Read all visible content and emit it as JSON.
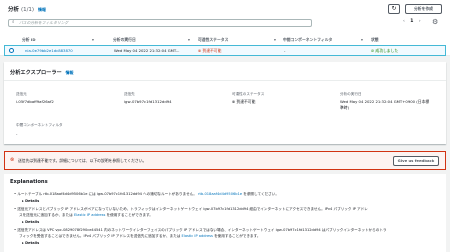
{
  "header": {
    "title": "分析",
    "count": "(1/1)",
    "info": "情報",
    "refresh_icon": "refresh-icon",
    "create_button": "分析を作成",
    "search_placeholder": "パスの分析をフィルタリング",
    "pager_prev": "‹",
    "pager_page": "1",
    "pager_next": "›"
  },
  "table": {
    "columns": [
      "分析 ID",
      "分析の実行日",
      "可達性ステータス",
      "中間コンポーネントフィルタ",
      "状態"
    ],
    "row": {
      "id": "nia-0e79bb2e1dc883870",
      "date": "Wed May 04 2022 21:32:04 GMT...",
      "reach": "到達不可能",
      "filter": "-",
      "state": "成功しました"
    }
  },
  "explorer": {
    "title": "分析エクスプローラー",
    "info": "情報",
    "source_label": "送信元",
    "source_value": "i-05f7dbaff9af26af2",
    "dest_label": "送信先",
    "dest_value": "igw-07b97c1fd1312dd94",
    "reach_label": "可達性のステータス",
    "reach_value": "到達不可能",
    "date_label": "分析の実行日",
    "date_value_1": "Wed May 04 2022 21:32:04 GMT+0900 (日本標",
    "date_value_2": "準時)",
    "filter_label": "中間コンポーネントフィルタ",
    "filter_value": "-"
  },
  "alert": {
    "text": "送信先は到達不能です。詳細については、以下の説明を参照してください。",
    "button": "Give us feedback"
  },
  "explanations": {
    "title": "Explanations",
    "items": [
      {
        "lead": "ルートテーブル rtb-018aaf4d4d9506b1e には igw-07b97c1fd1312dd94 への適切なルートがありません。",
        "link": "rtb-018aaf4d4d9506b1e",
        "tail": "を参照してください。",
        "details": "Details"
      },
      {
        "line1": "送信元アドレスとパブリック IP アドレスがペアになっていないため、トラフィックはインターネットゲートウェイ igw-07b97c1fd1312dd94 経由でインターネットにアクセスできません。IPv4 パブリック IP アドレ",
        "line2": "スを送信元に追加するか、または",
        "link": "Elastic IP address",
        "tail": "を使用することができます。",
        "details": "Details"
      },
      {
        "line1": "送信先アドレスは VPC vpc-0829078f290ce44541 内のネットワークインターフェイスのパブリック IP アドレスではない場合、インターネットゲートウェイ igw-07b97c1fd1312dd94 はパブリックインターネットからのトラ",
        "line2": "フィックを受信することはできません。IPv4 パブリック IP アドレスを送信先に追加するか、または",
        "link": "Elastic IP address",
        "tail": "を使用することができます。",
        "details": "Details"
      }
    ]
  }
}
